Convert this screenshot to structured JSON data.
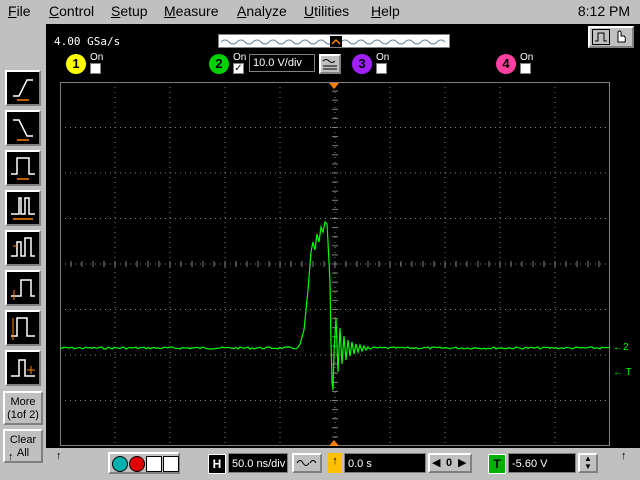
{
  "menu": {
    "items": [
      {
        "label": "File",
        "key": "F",
        "rest": "ile"
      },
      {
        "label": "Control",
        "key": "C",
        "rest": "ontrol"
      },
      {
        "label": "Setup",
        "key": "S",
        "rest": "etup"
      },
      {
        "label": "Measure",
        "key": "M",
        "rest": "easure"
      },
      {
        "label": "Analyze",
        "key": "A",
        "rest": "nalyze"
      },
      {
        "label": "Utilities",
        "key": "U",
        "rest": "tilities"
      },
      {
        "label": "Help",
        "key": "H",
        "rest": "elp"
      }
    ],
    "clock": "8:12 PM"
  },
  "acquisition": {
    "sample_rate": "4.00 GSa/s"
  },
  "channels": [
    {
      "number": "1",
      "on_label": "On",
      "checked": false,
      "color": "#ffff00"
    },
    {
      "number": "2",
      "on_label": "On",
      "checked": true,
      "color": "#00d000",
      "vdiv": "10.0 V/div"
    },
    {
      "number": "3",
      "on_label": "On",
      "checked": false,
      "color": "#a020ff"
    },
    {
      "number": "4",
      "on_label": "On",
      "checked": false,
      "color": "#ff40a0"
    }
  ],
  "sidebar": {
    "trigger_buttons": [
      "rising-edge",
      "falling-edge",
      "pulse-width",
      "glitch",
      "runt",
      "setup-hold",
      "transition",
      "timeout"
    ],
    "more_label_1": "More",
    "more_label_2": "(1of 2)",
    "clear_label_1": "Clear",
    "clear_label_2": "All"
  },
  "bottom": {
    "horizontal_letter": "H",
    "time_per_div": "50.0 ns/div",
    "delay": "0.0 s",
    "delay_letter": "0",
    "trigger_letter": "T",
    "trigger_level": "-5.60 V"
  },
  "markers": {
    "channel_ground": "2",
    "trigger_level_marker": "T"
  },
  "colors": {
    "trace": "#00ff00",
    "grid": "#808080",
    "accent_orange": "#ff8000"
  }
}
